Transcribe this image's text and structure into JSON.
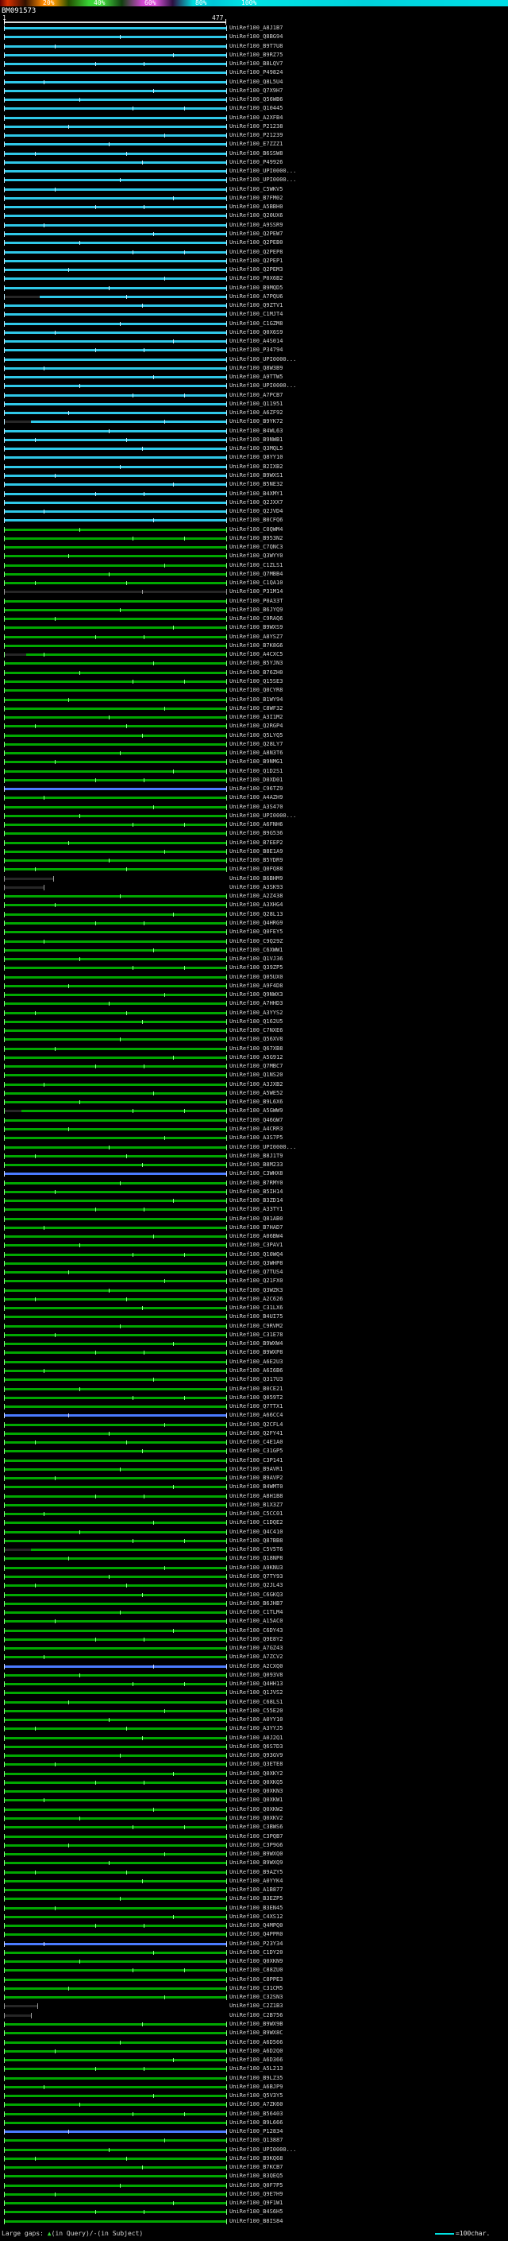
{
  "header": {
    "query_id": "BM091573",
    "scale_labels": [
      "20%",
      "40%",
      "60%",
      "80%",
      "100%"
    ],
    "ruler_start": "1",
    "ruler_end": "477"
  },
  "footer": {
    "large_gaps_label": "Large gaps: ",
    "gap_symbol": "▲",
    "gap_desc": "(in Query)/-(in Subject)",
    "scale_marker_text": "=100char."
  },
  "colors": {
    "cyan": "#2fc8e8",
    "green": "#00a800",
    "blue": "#4b7bff",
    "dark": "#262626",
    "cap_cyan": "#bfeeff",
    "cap_green": "#8cff8c",
    "cap_blue": "#cdd9ff",
    "cap_dark": "#9a9a9a",
    "ruler": "#d8d8d8",
    "label_text": "#d2d2d2",
    "footer_green": "#35d435",
    "marker_cyan": "#00e0e0"
  },
  "chart_data": {
    "type": "blast_alignment_overview",
    "query_length": 477,
    "num_hits": 246,
    "label_prefix": "UniRef100_",
    "tick_sets": [
      [],
      [
        0.52
      ],
      [
        0.23
      ],
      [
        0.76
      ],
      [
        0.41,
        0.63
      ],
      [],
      [
        0.18
      ],
      [
        0.67
      ],
      [
        0.34
      ],
      [
        0.58,
        0.81
      ],
      [],
      [
        0.29
      ],
      [
        0.72
      ],
      [
        0.47
      ],
      [
        0.14,
        0.55
      ],
      [
        0.62
      ]
    ],
    "rows": [
      [
        "A8J1B7",
        "c"
      ],
      [
        "Q8BG94",
        "c"
      ],
      [
        "B9T7U8",
        "c"
      ],
      [
        "B9RZ75",
        "c"
      ],
      [
        "B8LQV7",
        "c"
      ],
      [
        "P49824",
        "c"
      ],
      [
        "Q8L5U4",
        "c"
      ],
      [
        "Q7X9H7",
        "c"
      ],
      [
        "Q56WB6",
        "c"
      ],
      [
        "Q10445",
        "c"
      ],
      [
        "A2XFB4",
        "c"
      ],
      [
        "P21238",
        "c"
      ],
      [
        "P21239",
        "c"
      ],
      [
        "E7ZZZ1",
        "c"
      ],
      [
        "B6SSW8",
        "c"
      ],
      [
        "P49926",
        "c"
      ],
      [
        "UPI0000...",
        "c"
      ],
      [
        "UPI0000...",
        "c"
      ],
      [
        "C5WKV5",
        "c"
      ],
      [
        "B7FM02",
        "c"
      ],
      [
        "A5BBH0",
        "c"
      ],
      [
        "Q20UX6",
        "c"
      ],
      [
        "A9SSR9",
        "c"
      ],
      [
        "Q2PEW7",
        "c"
      ],
      [
        "Q2PEB0",
        "c"
      ],
      [
        "Q2PEP8",
        "c"
      ],
      [
        "Q2PEP1",
        "c"
      ],
      [
        "Q2PEM3",
        "c"
      ],
      [
        "P0X6B2",
        "c"
      ],
      [
        "B9MQD5",
        "c"
      ],
      [
        "A7PQU6",
        "c",
        1,
        0.16
      ],
      [
        "Q9ZTV1",
        "c"
      ],
      [
        "C1MJT4",
        "c"
      ],
      [
        "C1GZM8",
        "c"
      ],
      [
        "Q0X6S9",
        "c"
      ],
      [
        "A4S014",
        "c"
      ],
      [
        "P34794",
        "c"
      ],
      [
        "UPI0000...",
        "c"
      ],
      [
        "Q8W3B9",
        "c"
      ],
      [
        "A9TTW5",
        "c"
      ],
      [
        "UPI0000...",
        "c"
      ],
      [
        "A7PCB7",
        "c"
      ],
      [
        "Q11951",
        "c"
      ],
      [
        "A6ZF92",
        "c"
      ],
      [
        "B9YK72",
        "c",
        1,
        0.12
      ],
      [
        "B4WL63",
        "c"
      ],
      [
        "B9NWB1",
        "c"
      ],
      [
        "Q3MQL5",
        "c"
      ],
      [
        "Q8YY10",
        "c"
      ],
      [
        "B2IXB2",
        "c"
      ],
      [
        "B9WXS1",
        "c"
      ],
      [
        "B5NE32",
        "c"
      ],
      [
        "B4XMY1",
        "c"
      ],
      [
        "Q2JXX7",
        "c"
      ],
      [
        "Q2JVD4",
        "c"
      ],
      [
        "B0CFQ6",
        "c"
      ],
      [
        "C0QWM4",
        "g"
      ],
      [
        "B953N2",
        "g"
      ],
      [
        "C7QNC3",
        "g"
      ],
      [
        "Q3WYY0",
        "g"
      ],
      [
        "C1ZLS1",
        "g"
      ],
      [
        "Q7MBB4",
        "g"
      ],
      [
        "C1QA10",
        "g"
      ],
      [
        "P31M14",
        "k"
      ],
      [
        "P0A33T",
        "g"
      ],
      [
        "B6JYQ9",
        "g"
      ],
      [
        "C9RAQ6",
        "g"
      ],
      [
        "B9WXS9",
        "g"
      ],
      [
        "A8YSZ7",
        "g"
      ],
      [
        "B7K8G6",
        "g"
      ],
      [
        "A4CXC5",
        "g",
        1,
        0.1
      ],
      [
        "B5YJN3",
        "g"
      ],
      [
        "B76ZH0",
        "g"
      ],
      [
        "Q15SE3",
        "g"
      ],
      [
        "Q0CYR8",
        "g"
      ],
      [
        "B1WY94",
        "g"
      ],
      [
        "C8WF32",
        "g"
      ],
      [
        "A3I1M2",
        "g"
      ],
      [
        "Q2RGP4",
        "g"
      ],
      [
        "Q5LYQ5",
        "g"
      ],
      [
        "Q28LY7",
        "g"
      ],
      [
        "A8N3T6",
        "g"
      ],
      [
        "B9NMG1",
        "g"
      ],
      [
        "Q1D2S1",
        "g"
      ],
      [
        "D0XD01",
        "g"
      ],
      [
        "C96TZ9",
        "b"
      ],
      [
        "A4AZH9",
        "g"
      ],
      [
        "A3S470",
        "g"
      ],
      [
        "UPI0000...",
        "g"
      ],
      [
        "A6FNH6",
        "g"
      ],
      [
        "B9G536",
        "g"
      ],
      [
        "B7EEP2",
        "g"
      ],
      [
        "B8E1A9",
        "g"
      ],
      [
        "B5YDR9",
        "g"
      ],
      [
        "Q0FQ88",
        "g"
      ],
      [
        "B6BHM9",
        "k",
        0.22
      ],
      [
        "A3SK93",
        "k",
        0.18
      ],
      [
        "A2Z438",
        "g"
      ],
      [
        "A3XHG4",
        "g"
      ],
      [
        "Q28L13",
        "g"
      ],
      [
        "Q4HRG9",
        "g"
      ],
      [
        "Q0FEY5",
        "g"
      ],
      [
        "C9Q29Z",
        "g"
      ],
      [
        "C6XWW1",
        "g"
      ],
      [
        "Q1VJ36",
        "g"
      ],
      [
        "Q39ZP5",
        "g"
      ],
      [
        "Q05UX0",
        "g"
      ],
      [
        "A9F4D8",
        "g"
      ],
      [
        "Q9NWX3",
        "g"
      ],
      [
        "A7HHD3",
        "g"
      ],
      [
        "A3YYS2",
        "g"
      ],
      [
        "Q162U5",
        "g"
      ],
      [
        "C7NXE6",
        "g"
      ],
      [
        "Q56XV8",
        "g"
      ],
      [
        "Q67XB8",
        "g"
      ],
      [
        "A5G912",
        "g"
      ],
      [
        "Q7MBC7",
        "g"
      ],
      [
        "Q1NS20",
        "g"
      ],
      [
        "A3JXB2",
        "g"
      ],
      [
        "A5WE52",
        "g"
      ],
      [
        "B9L6X6",
        "g"
      ],
      [
        "A5GWW9",
        "g",
        1,
        0.08
      ],
      [
        "Q46GW7",
        "g"
      ],
      [
        "A4CRR3",
        "g"
      ],
      [
        "A3S7P5",
        "g"
      ],
      [
        "UPI0000...",
        "g"
      ],
      [
        "B8J1T9",
        "g"
      ],
      [
        "B8M233",
        "g"
      ],
      [
        "C3WHX8",
        "b"
      ],
      [
        "B7RMY0",
        "g"
      ],
      [
        "B5IH14",
        "g"
      ],
      [
        "B3ZD14",
        "g"
      ],
      [
        "A33TY1",
        "g"
      ],
      [
        "Q81AB0",
        "g"
      ],
      [
        "B7HAD7",
        "g"
      ],
      [
        "A06BW4",
        "g"
      ],
      [
        "C3PAV1",
        "g"
      ],
      [
        "Q10WQ4",
        "g"
      ],
      [
        "Q3WHP8",
        "g"
      ],
      [
        "Q7TUS4",
        "g"
      ],
      [
        "Q21FX0",
        "g"
      ],
      [
        "Q3WZK3",
        "g"
      ],
      [
        "A2C626",
        "g"
      ],
      [
        "C31LX6",
        "g"
      ],
      [
        "B4UI75",
        "g"
      ],
      [
        "C9RVM2",
        "g"
      ],
      [
        "C31E78",
        "g"
      ],
      [
        "B9WXW4",
        "g"
      ],
      [
        "B9WXP8",
        "g"
      ],
      [
        "A6E2U3",
        "g"
      ],
      [
        "A6I6B6",
        "g"
      ],
      [
        "Q317U3",
        "g"
      ],
      [
        "B0CE21",
        "g"
      ],
      [
        "Q059T2",
        "g"
      ],
      [
        "Q7TTX1",
        "g"
      ],
      [
        "A66CC4",
        "b"
      ],
      [
        "Q2CFL4",
        "g"
      ],
      [
        "Q2FY41",
        "g"
      ],
      [
        "C4E1A0",
        "g"
      ],
      [
        "C31GP5",
        "g"
      ],
      [
        "C3P141",
        "g"
      ],
      [
        "B9AVR1",
        "g"
      ],
      [
        "B9AVP2",
        "g"
      ],
      [
        "B4WMT0",
        "g"
      ],
      [
        "A8H1B8",
        "g"
      ],
      [
        "B1X3Z7",
        "g"
      ],
      [
        "C5CC01",
        "g"
      ],
      [
        "C1DQE2",
        "g"
      ],
      [
        "Q4C410",
        "g"
      ],
      [
        "Q87BB8",
        "g"
      ],
      [
        "C5V5T6",
        "g",
        1,
        0.12
      ],
      [
        "Q18NP8",
        "g"
      ],
      [
        "A9KNU3",
        "g"
      ],
      [
        "Q7TY93",
        "g"
      ],
      [
        "Q2JL43",
        "g"
      ],
      [
        "C6GKQ3",
        "g"
      ],
      [
        "B6JHB7",
        "g"
      ],
      [
        "C1TLM4",
        "g"
      ],
      [
        "A15AC0",
        "g"
      ],
      [
        "C6DY43",
        "g"
      ],
      [
        "Q9E8Y2",
        "g"
      ],
      [
        "A7GZ43",
        "g"
      ],
      [
        "A7ZCV2",
        "g"
      ],
      [
        "A2CXQ0",
        "b"
      ],
      [
        "Q093V8",
        "g"
      ],
      [
        "Q4HH13",
        "g"
      ],
      [
        "Q1JVS2",
        "g"
      ],
      [
        "C68LS1",
        "g"
      ],
      [
        "C55E20",
        "g"
      ],
      [
        "A0YY10",
        "g"
      ],
      [
        "A3YYJ5",
        "g"
      ],
      [
        "A0J2Q1",
        "g"
      ],
      [
        "Q6S7D3",
        "g"
      ],
      [
        "Q93GV9",
        "g"
      ],
      [
        "Q3ETE8",
        "g"
      ],
      [
        "Q0XKY2",
        "g"
      ],
      [
        "Q0XKQ5",
        "g"
      ],
      [
        "Q0XKN3",
        "g"
      ],
      [
        "Q0XKW1",
        "g"
      ],
      [
        "Q0XKW2",
        "g"
      ],
      [
        "Q0XKV2",
        "g"
      ],
      [
        "C3BWS6",
        "g"
      ],
      [
        "C3PQB7",
        "g"
      ],
      [
        "C3P9G6",
        "g"
      ],
      [
        "B9WXQ0",
        "g"
      ],
      [
        "B9WXQ9",
        "g"
      ],
      [
        "B9AZY5",
        "g"
      ],
      [
        "A0YYK4",
        "g"
      ],
      [
        "A1B877",
        "g"
      ],
      [
        "B3EZP5",
        "g"
      ],
      [
        "B3EN45",
        "g"
      ],
      [
        "C4XS12",
        "g"
      ],
      [
        "Q4MPQ0",
        "g"
      ],
      [
        "Q4PPR0",
        "g"
      ],
      [
        "P23Y34",
        "b"
      ],
      [
        "C1DY20",
        "g"
      ],
      [
        "Q0XKN9",
        "g"
      ],
      [
        "C88ZU0",
        "g"
      ],
      [
        "C8PPE3",
        "g"
      ],
      [
        "C31CM5",
        "g"
      ],
      [
        "C32SN3",
        "g"
      ],
      [
        "C2Z1B3",
        "k",
        0.15
      ],
      [
        "C2B756",
        "k",
        0.12
      ],
      [
        "B9WX9B",
        "g"
      ],
      [
        "B9WX8C",
        "g"
      ],
      [
        "A6D566",
        "g"
      ],
      [
        "A6D2Q0",
        "g"
      ],
      [
        "A6D366",
        "g"
      ],
      [
        "A5L213",
        "g"
      ],
      [
        "B9LZ35",
        "g"
      ],
      [
        "A6BJP9",
        "g"
      ],
      [
        "Q5V3Y5",
        "g"
      ],
      [
        "A7ZK60",
        "g"
      ],
      [
        "B56403",
        "g"
      ],
      [
        "B9L666",
        "g"
      ],
      [
        "P12834",
        "b"
      ],
      [
        "Q13887",
        "g"
      ],
      [
        "UPI0000...",
        "g"
      ],
      [
        "B9KQ68",
        "g"
      ],
      [
        "B7KCB7",
        "g"
      ],
      [
        "B3QEQ5",
        "g"
      ],
      [
        "Q0F7P5",
        "g"
      ],
      [
        "Q9E7H9",
        "g"
      ],
      [
        "Q9F1W1",
        "g"
      ],
      [
        "B4S6H5",
        "g"
      ],
      [
        "B8IS84",
        "g"
      ]
    ]
  }
}
